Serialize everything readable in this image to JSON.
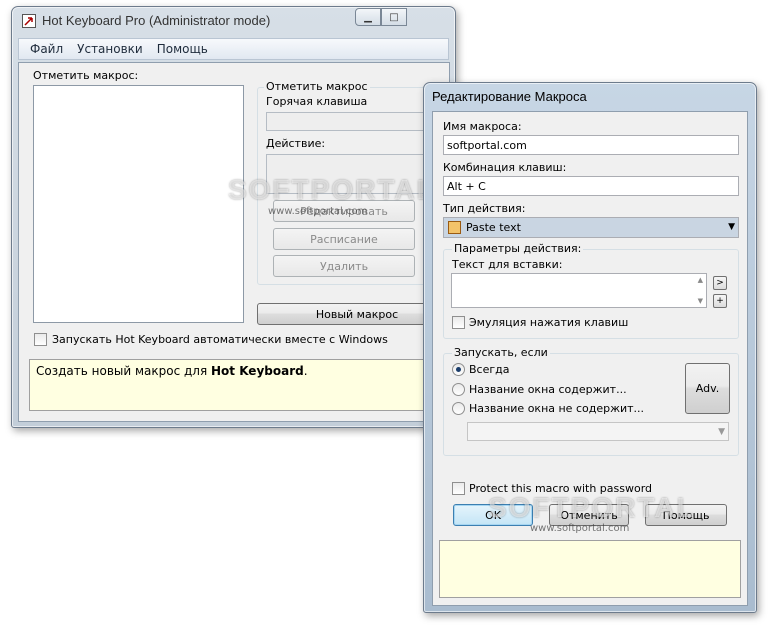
{
  "main_window": {
    "title": "Hot Keyboard Pro (Administrator mode)",
    "menu": [
      "Файл",
      "Установки",
      "Помощь"
    ],
    "macros_list_label": "Отметить макрос:",
    "group_title": "Отметить макрос",
    "hotkey_label": "Горячая клавиша",
    "action_label": "Действие:",
    "edit_button": "Редактировать",
    "schedule_button": "Расписание",
    "delete_button": "Удалить",
    "new_macro_button": "Новый макрос",
    "autostart_label": "Запускать Hot Keyboard автоматически вместе с Windows",
    "hint_prefix": "Создать новый макрос для ",
    "hint_bold": "Hot Keyboard",
    "hint_suffix": "."
  },
  "dialog": {
    "title": "Редактирование Макроса",
    "macro_name_label": "Имя макроса:",
    "macro_name_value": "softportal.com",
    "key_combo_label": "Комбинация клавиш:",
    "key_combo_value": "Alt + C",
    "action_type_label": "Тип действия:",
    "action_type_value": "Paste text",
    "action_params_title": "Параметры действия:",
    "paste_text_label": "Текст для вставки:",
    "emulate_keys_label": "Эмуляция нажатия клавиш",
    "run_if_title": "Запускать, если",
    "radio_always": "Всегда",
    "radio_window_contains": "Название окна содержит...",
    "radio_window_not_contains": "Название окна не содержит...",
    "adv_button": "Adv.",
    "protect_label": "Protect this macro with password",
    "ok_button": "OK",
    "cancel_button": "Отменить",
    "help_button": "Помощь"
  },
  "watermarks": [
    {
      "text": "SOFTPORTAL",
      "sub": "www.softportal.com"
    },
    {
      "text": "SOFTPORTAL",
      "sub": "www.softportal.com"
    }
  ]
}
